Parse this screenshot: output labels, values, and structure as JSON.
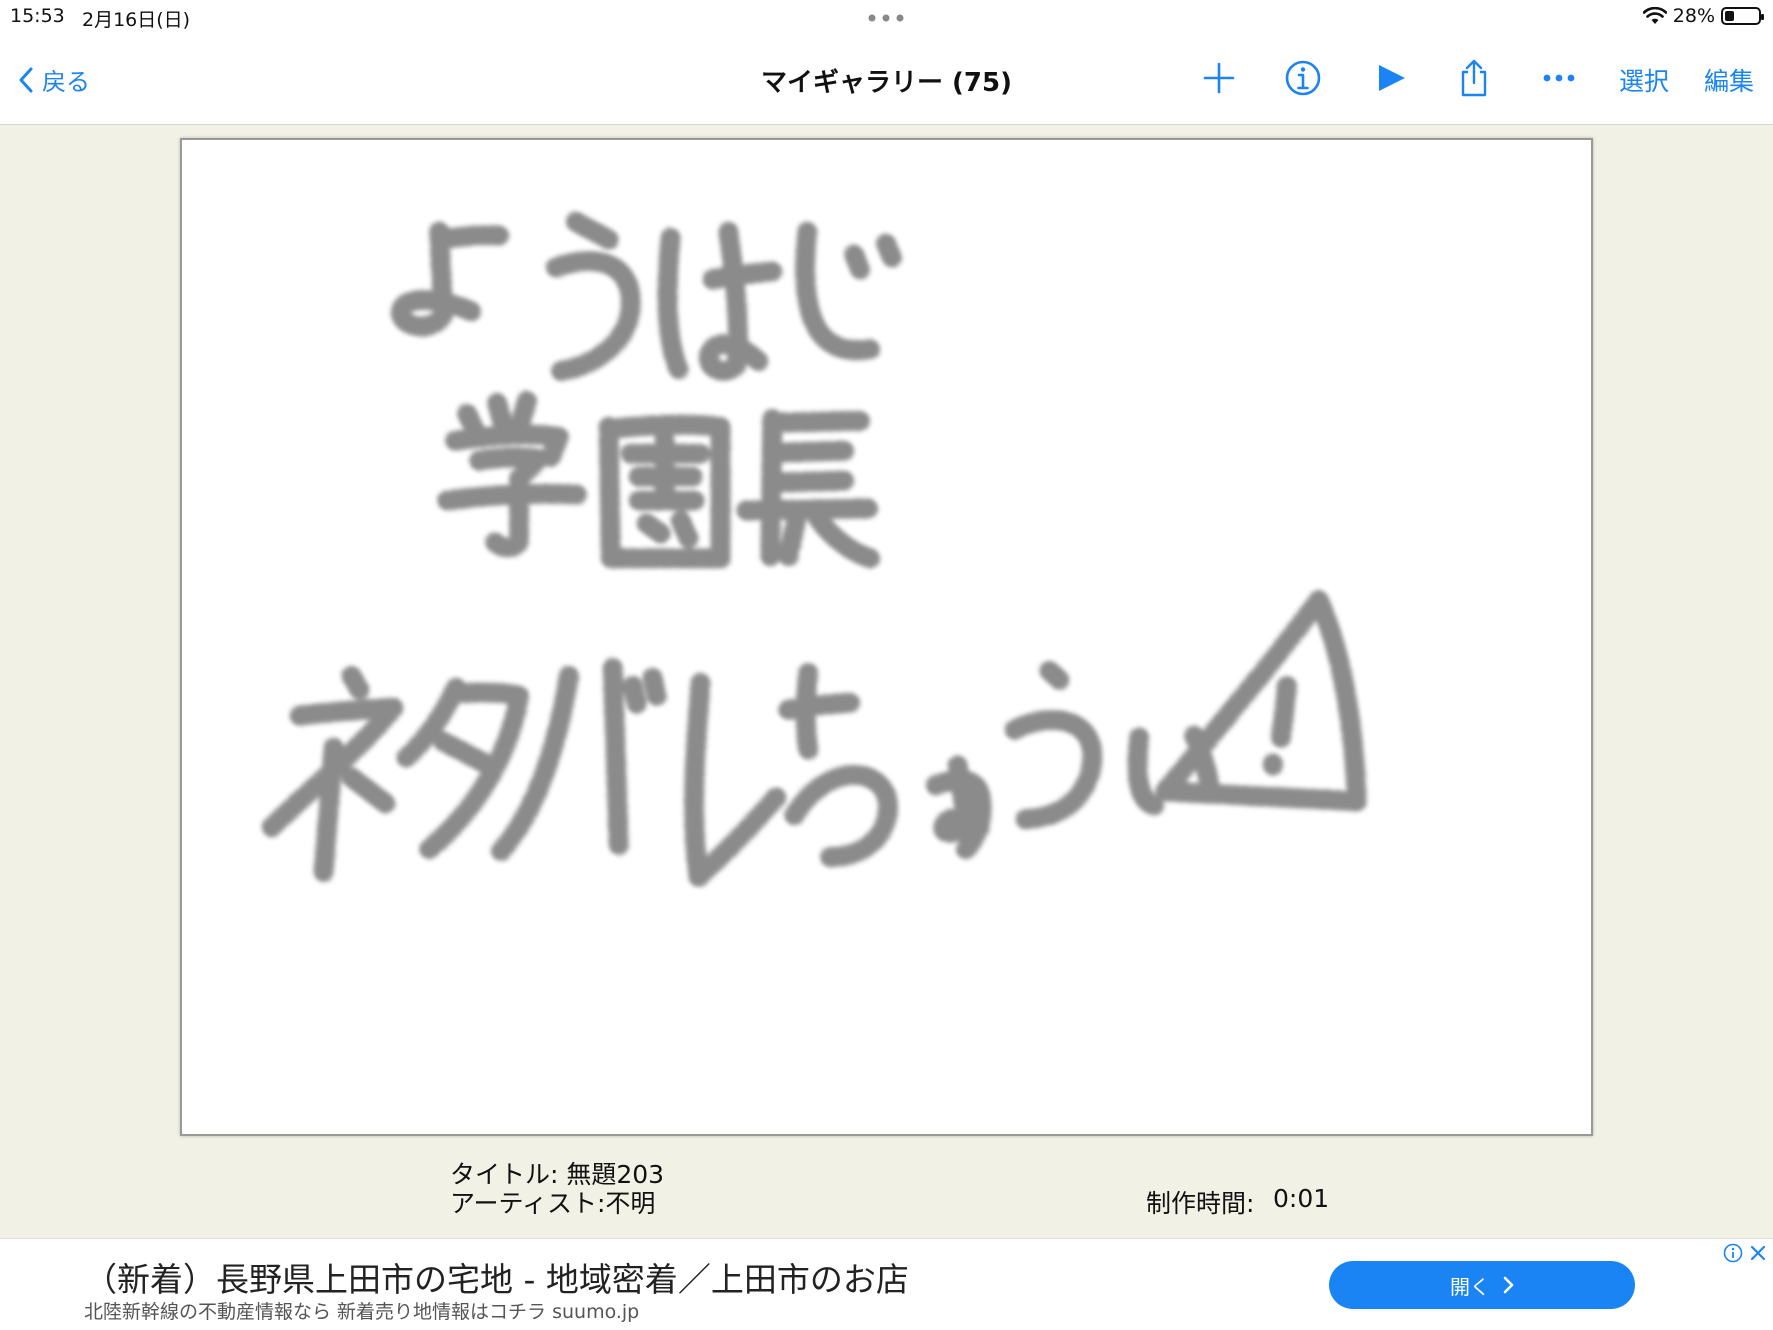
{
  "status_bar": {
    "time": "15:53",
    "date": "2月16日(日)",
    "battery_percent": "28%",
    "battery_level": 0.28
  },
  "nav": {
    "back_label": "戻る",
    "title": "マイギャラリー (75)",
    "select_label": "選択",
    "edit_label": "編集",
    "icons": [
      "plus-icon",
      "info-icon",
      "play-icon",
      "share-icon",
      "more-icon"
    ],
    "accent_color": "#1a84f5"
  },
  "artwork": {
    "handwritten_lines": [
      "ようはじ",
      "学園長",
      "ネタバレちゅうい"
    ]
  },
  "info": {
    "title_line": "タイトル: 無題203",
    "artist_line": "アーティスト:不明",
    "time_label": "制作時間:",
    "time_value": "0:01"
  },
  "ad": {
    "headline": "（新着）長野県上田市の宅地 - 地域密着／上田市のお店",
    "subtext": "北陸新幹線の不動産情報なら 新着売り地情報はコチラ suumo.jp",
    "button_label": "開く"
  }
}
